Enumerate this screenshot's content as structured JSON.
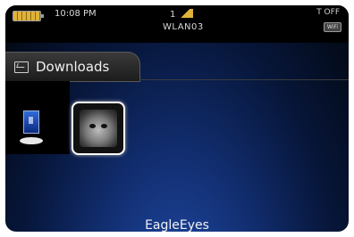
{
  "status_bar": {
    "time": "10:08 PM",
    "signal_text": "1",
    "network": "WLAN03",
    "right_top": "T OFF",
    "right_badge": "WiFi"
  },
  "tab": {
    "label": "Downloads"
  },
  "caption": "EagleEyes",
  "icons": [
    "downloads-folder-icon",
    "computer-icon",
    "owl-app-icon"
  ],
  "colors": {
    "background_top": "#000000",
    "background_glow": "#1f4aa8",
    "battery": "#e0b23a"
  }
}
